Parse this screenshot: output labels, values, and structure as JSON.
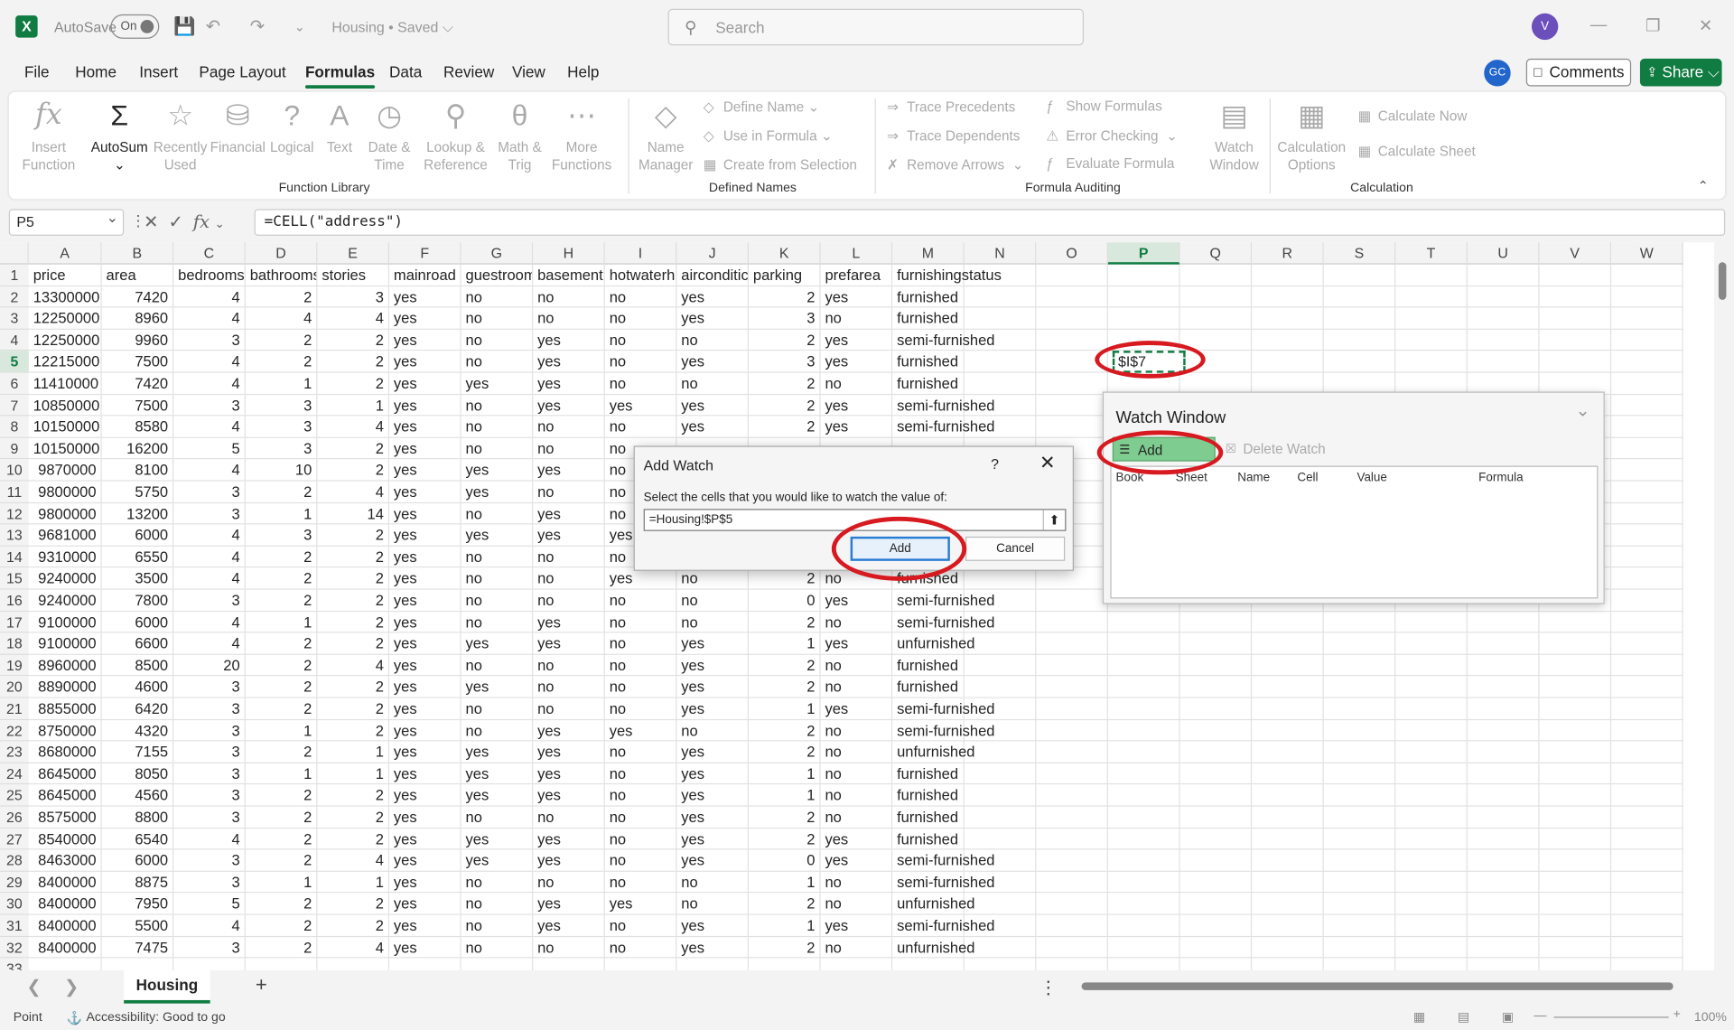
{
  "titlebar": {
    "autosave": "AutoSave",
    "toggle": "On",
    "doc": "Housing • Saved ⌵",
    "search": "Search",
    "avatar": "V"
  },
  "menu": [
    "File",
    "Home",
    "Insert",
    "Page Layout",
    "Formulas",
    "Data",
    "Review",
    "View",
    "Help"
  ],
  "account": {
    "gc": "GC",
    "comments": "Comments",
    "share": "Share ⌵"
  },
  "ribbon": {
    "insert_function": "Insert\nFunction",
    "autosum": "AutoSum",
    "recently_used": "Recently\nUsed",
    "financial": "Financial",
    "logical": "Logical",
    "text": "Text",
    "date_time": "Date &\nTime",
    "lookup": "Lookup &\nReference",
    "math": "Math &\nTrig",
    "more": "More\nFunctions",
    "name_manager": "Name\nManager",
    "define_name": "Define Name",
    "use_in_formula": "Use in Formula",
    "create_from_selection": "Create from Selection",
    "trace_precedents": "Trace Precedents",
    "trace_dependents": "Trace Dependents",
    "remove_arrows": "Remove Arrows",
    "show_formulas": "Show Formulas",
    "error_checking": "Error Checking",
    "evaluate_formula": "Evaluate Formula",
    "watch_window": "Watch\nWindow",
    "calc_options": "Calculation\nOptions",
    "calc_now": "Calculate Now",
    "calc_sheet": "Calculate Sheet",
    "groups": [
      "Function Library",
      "Defined Names",
      "Formula Auditing",
      "Calculation"
    ]
  },
  "formula_bar": {
    "name": "P5",
    "formula": "=CELL(\"address\")"
  },
  "columns": [
    "A",
    "B",
    "C",
    "D",
    "E",
    "F",
    "G",
    "H",
    "I",
    "J",
    "K",
    "L",
    "M",
    "N",
    "O",
    "P",
    "Q",
    "R",
    "S",
    "T",
    "U",
    "V",
    "W"
  ],
  "headers": [
    "price",
    "area",
    "bedrooms",
    "bathrooms",
    "stories",
    "mainroad",
    "guestroom",
    "basement",
    "hotwaterh",
    "airconditic",
    "parking",
    "prefarea",
    "furnishingstatus"
  ],
  "rows": [
    [
      "13300000",
      "7420",
      "4",
      "2",
      "3",
      "yes",
      "no",
      "no",
      "no",
      "yes",
      "2",
      "yes",
      "furnished"
    ],
    [
      "12250000",
      "8960",
      "4",
      "4",
      "4",
      "yes",
      "no",
      "no",
      "no",
      "yes",
      "3",
      "no",
      "furnished"
    ],
    [
      "12250000",
      "9960",
      "3",
      "2",
      "2",
      "yes",
      "no",
      "yes",
      "no",
      "no",
      "2",
      "yes",
      "semi-furnished"
    ],
    [
      "12215000",
      "7500",
      "4",
      "2",
      "2",
      "yes",
      "no",
      "yes",
      "no",
      "yes",
      "3",
      "yes",
      "furnished"
    ],
    [
      "11410000",
      "7420",
      "4",
      "1",
      "2",
      "yes",
      "yes",
      "yes",
      "no",
      "no",
      "2",
      "no",
      "furnished"
    ],
    [
      "10850000",
      "7500",
      "3",
      "3",
      "1",
      "yes",
      "no",
      "yes",
      "yes",
      "yes",
      "2",
      "yes",
      "semi-furnished"
    ],
    [
      "10150000",
      "8580",
      "4",
      "3",
      "4",
      "yes",
      "no",
      "no",
      "no",
      "yes",
      "2",
      "yes",
      "semi-furnished"
    ],
    [
      "10150000",
      "16200",
      "5",
      "3",
      "2",
      "yes",
      "no",
      "no",
      "no",
      "",
      "",
      "",
      ""
    ],
    [
      "9870000",
      "8100",
      "4",
      "10",
      "2",
      "yes",
      "yes",
      "yes",
      "no",
      "",
      "",
      "",
      ""
    ],
    [
      "9800000",
      "5750",
      "3",
      "2",
      "4",
      "yes",
      "yes",
      "no",
      "no",
      "",
      "",
      "",
      ""
    ],
    [
      "9800000",
      "13200",
      "3",
      "1",
      "14",
      "yes",
      "no",
      "yes",
      "no",
      "",
      "",
      "",
      ""
    ],
    [
      "9681000",
      "6000",
      "4",
      "3",
      "2",
      "yes",
      "yes",
      "yes",
      "yes",
      "",
      "",
      "",
      ""
    ],
    [
      "9310000",
      "6550",
      "4",
      "2",
      "2",
      "yes",
      "no",
      "no",
      "no",
      "",
      "",
      "",
      ""
    ],
    [
      "9240000",
      "3500",
      "4",
      "2",
      "2",
      "yes",
      "no",
      "no",
      "yes",
      "no",
      "2",
      "no",
      "furnished"
    ],
    [
      "9240000",
      "7800",
      "3",
      "2",
      "2",
      "yes",
      "no",
      "no",
      "no",
      "no",
      "0",
      "yes",
      "semi-furnished"
    ],
    [
      "9100000",
      "6000",
      "4",
      "1",
      "2",
      "yes",
      "no",
      "yes",
      "no",
      "no",
      "2",
      "no",
      "semi-furnished"
    ],
    [
      "9100000",
      "6600",
      "4",
      "2",
      "2",
      "yes",
      "yes",
      "yes",
      "no",
      "yes",
      "1",
      "yes",
      "unfurnished"
    ],
    [
      "8960000",
      "8500",
      "20",
      "2",
      "4",
      "yes",
      "no",
      "no",
      "no",
      "yes",
      "2",
      "no",
      "furnished"
    ],
    [
      "8890000",
      "4600",
      "3",
      "2",
      "2",
      "yes",
      "yes",
      "no",
      "no",
      "yes",
      "2",
      "no",
      "furnished"
    ],
    [
      "8855000",
      "6420",
      "3",
      "2",
      "2",
      "yes",
      "no",
      "no",
      "no",
      "yes",
      "1",
      "yes",
      "semi-furnished"
    ],
    [
      "8750000",
      "4320",
      "3",
      "1",
      "2",
      "yes",
      "no",
      "yes",
      "yes",
      "no",
      "2",
      "no",
      "semi-furnished"
    ],
    [
      "8680000",
      "7155",
      "3",
      "2",
      "1",
      "yes",
      "yes",
      "yes",
      "no",
      "yes",
      "2",
      "no",
      "unfurnished"
    ],
    [
      "8645000",
      "8050",
      "3",
      "1",
      "1",
      "yes",
      "yes",
      "yes",
      "no",
      "yes",
      "1",
      "no",
      "furnished"
    ],
    [
      "8645000",
      "4560",
      "3",
      "2",
      "2",
      "yes",
      "yes",
      "yes",
      "no",
      "yes",
      "1",
      "no",
      "furnished"
    ],
    [
      "8575000",
      "8800",
      "3",
      "2",
      "2",
      "yes",
      "no",
      "no",
      "no",
      "yes",
      "2",
      "no",
      "furnished"
    ],
    [
      "8540000",
      "6540",
      "4",
      "2",
      "2",
      "yes",
      "yes",
      "yes",
      "no",
      "yes",
      "2",
      "yes",
      "furnished"
    ],
    [
      "8463000",
      "6000",
      "3",
      "2",
      "4",
      "yes",
      "yes",
      "yes",
      "no",
      "yes",
      "0",
      "yes",
      "semi-furnished"
    ],
    [
      "8400000",
      "8875",
      "3",
      "1",
      "1",
      "yes",
      "no",
      "no",
      "no",
      "no",
      "1",
      "no",
      "semi-furnished"
    ],
    [
      "8400000",
      "7950",
      "5",
      "2",
      "2",
      "yes",
      "no",
      "yes",
      "yes",
      "no",
      "2",
      "no",
      "unfurnished"
    ],
    [
      "8400000",
      "5500",
      "4",
      "2",
      "2",
      "yes",
      "no",
      "yes",
      "no",
      "yes",
      "1",
      "yes",
      "semi-furnished"
    ],
    [
      "8400000",
      "7475",
      "3",
      "2",
      "4",
      "yes",
      "no",
      "no",
      "no",
      "yes",
      "2",
      "no",
      "unfurnished"
    ]
  ],
  "active_cell_value": "$I$7",
  "sheet_tab": "Housing",
  "status": {
    "mode": "Point",
    "accessibility": "Accessibility: Good to go",
    "zoom": "100%"
  },
  "watch_window": {
    "title": "Watch Window",
    "add": "Add Watch...",
    "delete": "Delete Watch",
    "cols": [
      "Book",
      "Sheet",
      "Name",
      "Cell",
      "Value",
      "Formula"
    ]
  },
  "add_watch": {
    "title": "Add Watch",
    "help": "?",
    "prompt": "Select the cells that you would like to watch the value of:",
    "ref": "=Housing!$P$5",
    "add": "Add",
    "cancel": "Cancel"
  }
}
